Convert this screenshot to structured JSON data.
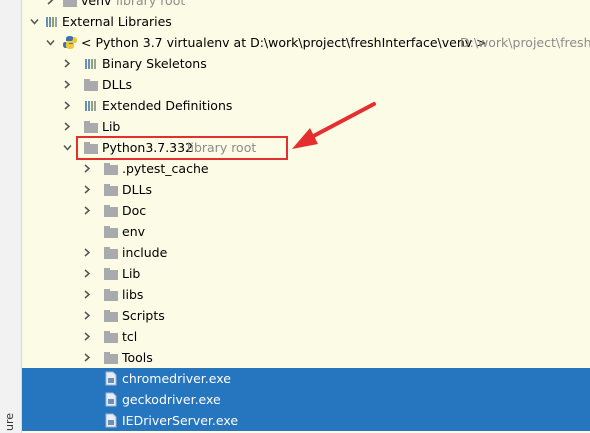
{
  "gutter": {
    "label": "ure"
  },
  "tree": {
    "venv_row": {
      "name": "venv",
      "hint": "library root"
    },
    "external_libraries": {
      "label": "External Libraries"
    },
    "python_env": {
      "label": "< Python 3.7 virtualenv at D:\\work\\project\\freshInterface\\venv >",
      "path_hint": "D:\\work\\project\\freshI"
    },
    "env_children": [
      {
        "name": "Binary Skeletons"
      },
      {
        "name": "DLLs"
      },
      {
        "name": "Extended Definitions"
      },
      {
        "name": "Lib"
      }
    ],
    "python_root": {
      "name": "Python3.7.332",
      "hint": "library root"
    },
    "python_children": [
      {
        "name": ".pytest_cache"
      },
      {
        "name": "DLLs"
      },
      {
        "name": "Doc"
      },
      {
        "name": "env"
      },
      {
        "name": "include"
      },
      {
        "name": "Lib"
      },
      {
        "name": "libs"
      },
      {
        "name": "Scripts"
      },
      {
        "name": "tcl"
      },
      {
        "name": "Tools"
      }
    ],
    "executables": [
      {
        "name": "chromedriver.exe"
      },
      {
        "name": "geckodriver.exe"
      },
      {
        "name": "IEDriverServer.exe"
      }
    ]
  },
  "colors": {
    "background": "#fcfbe6",
    "selection": "#2675bf",
    "annotation": "#e52f2f",
    "hint_text": "#8c8c8c"
  },
  "icons": {
    "folder": "folder-icon",
    "library_group": "library-bars-icon",
    "python": "python-logo-icon",
    "executable": "executable-file-icon",
    "expanded": "chevron-down-icon",
    "collapsed": "chevron-right-icon"
  }
}
